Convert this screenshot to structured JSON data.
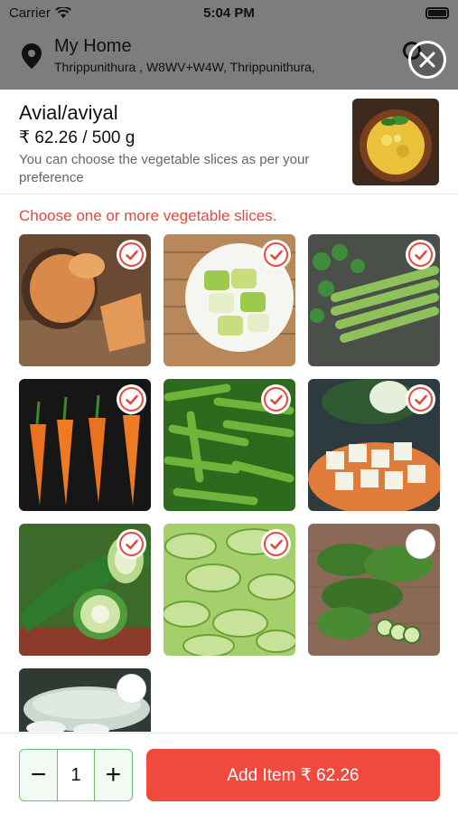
{
  "status_bar": {
    "carrier": "Carrier",
    "time": "5:04 PM"
  },
  "location": {
    "title": "My Home",
    "address": "Thrippunithura , W8WV+W4W, Thrippunithura,",
    "icon": "location-pin-icon"
  },
  "product": {
    "title": "Avial/aviyal",
    "price": "₹ 62.26 / 500 g",
    "description": "You can choose the vegetable slices as per your preference"
  },
  "instruction": "Choose one or more vegetable slices.",
  "options": [
    {
      "name": "yam",
      "selected": true
    },
    {
      "name": "ash-gourd-pieces",
      "selected": true
    },
    {
      "name": "drumstick",
      "selected": true
    },
    {
      "name": "carrot",
      "selected": true
    },
    {
      "name": "beans",
      "selected": true
    },
    {
      "name": "pumpkin-cubes",
      "selected": true
    },
    {
      "name": "snake-gourd",
      "selected": true
    },
    {
      "name": "cucumber-slices",
      "selected": true
    },
    {
      "name": "bitter-gourd",
      "selected": false
    },
    {
      "name": "ash-gourd",
      "selected": false
    }
  ],
  "footer": {
    "decrement_label": "−",
    "quantity": "1",
    "increment_label": "+",
    "add_label": "Add Item ₹ 62.26"
  },
  "colors": {
    "accent": "#ef4a3d",
    "stepper_border": "#6cc06c",
    "overlay": "#7d7d7d"
  }
}
